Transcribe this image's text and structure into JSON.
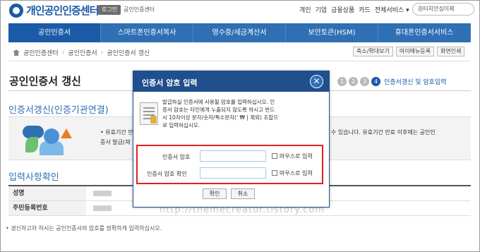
{
  "header": {
    "logo_text": "개인공인인증센터",
    "login_label": "로그인",
    "site_label": "공인인증센터",
    "top_links": [
      "개인",
      "기업",
      "금융상품",
      "카드",
      "전체서비스 ▾"
    ],
    "remote_label": "원터치안심이체"
  },
  "nav": {
    "items": [
      "공인인증서",
      "스마트폰인증서복사",
      "영수증/세금계산서",
      "보안토큰(HSM)",
      "휴대폰인증서서비스"
    ]
  },
  "breadcrumb": {
    "items": [
      "공인인증센터",
      "공인인증서",
      "공인인증서 갱신"
    ],
    "sep": "›"
  },
  "util_buttons": [
    "축소/확대보기",
    "마이메뉴등록",
    "화면인쇄"
  ],
  "page": {
    "title": "공인인증서 갱신",
    "steps": [
      "1",
      "2",
      "3",
      "4"
    ],
    "step_label": "인증서갱신 및 암호입력",
    "section1": "인증서갱신(인증기관연결)",
    "info_line1": "• 유효기간 만",
    "info_line2": "증서 발급(재",
    "info_right1": "수 있습니다. 유효기간 만료 이후에는 공인인",
    "info_right2": "",
    "section2": "입력사항확인",
    "table_labels": [
      "성명",
      "주민등록번호"
    ],
    "note": "• 경신하고자 하시는 공인인증서의 암호를 정확하게 입력하십시오.",
    "watermark": "http://themecreator.tistory.com"
  },
  "modal": {
    "title": "인증서 암호 입력",
    "close_label": "✕",
    "desc": [
      "발급하실 인증서에 사용될 암호를 입력하십시오. 인",
      "증서 암호는 타인에게 누출되지 않도록 하시고 반드",
      "시 10자이상 문자/숫자/특수문자(' ₩ | 제외) 조합으",
      "로 입력하십시오."
    ],
    "password_label": "인증서 암호",
    "confirm_label": "인증서 암호 확인",
    "mouse_input_label": "마우스로 입력",
    "ok_label": "확인",
    "cancel_label": "취소"
  }
}
